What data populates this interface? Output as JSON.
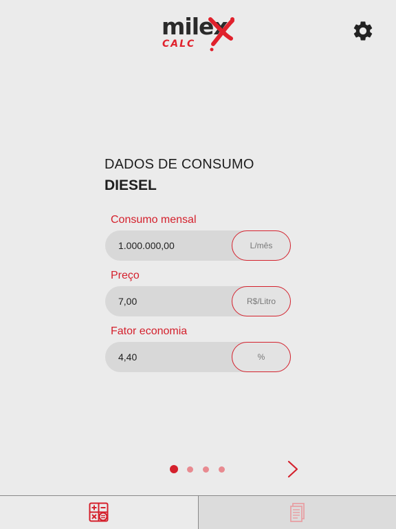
{
  "header": {
    "logo_text": "milex",
    "logo_sub": "CALC",
    "settings_icon": "gear-icon"
  },
  "title": "DADOS DE CONSUMO",
  "subtitle": "DIESEL",
  "fields": [
    {
      "label": "Consumo mensal",
      "value": "1.000.000,00",
      "unit": "L/mês"
    },
    {
      "label": "Preço",
      "value": "7,00",
      "unit": "R$/Litro"
    },
    {
      "label": "Fator economia",
      "value": "4,40",
      "unit": "%"
    }
  ],
  "pager": {
    "pages": 4,
    "current": 1,
    "next_icon": "chevron-right-icon"
  },
  "tabs": [
    {
      "icon": "calculator-icon",
      "active": true
    },
    {
      "icon": "document-icon",
      "active": false
    }
  ],
  "colors": {
    "accent": "#d4202c",
    "background": "#ebebeb",
    "field_bg": "#d8d8d8"
  }
}
